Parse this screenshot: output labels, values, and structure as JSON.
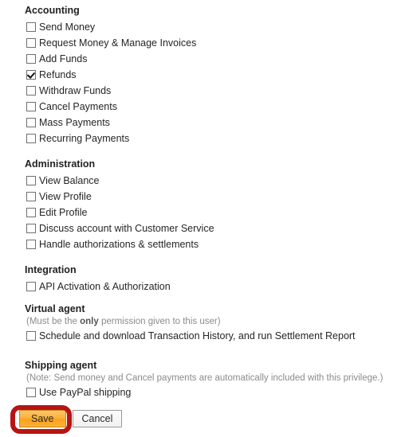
{
  "sections": [
    {
      "title": "Accounting",
      "note": null,
      "options": [
        {
          "label": "Send Money",
          "checked": false
        },
        {
          "label": "Request Money & Manage Invoices",
          "checked": false
        },
        {
          "label": "Add Funds",
          "checked": false
        },
        {
          "label": "Refunds",
          "checked": true
        },
        {
          "label": "Withdraw Funds",
          "checked": false
        },
        {
          "label": "Cancel Payments",
          "checked": false
        },
        {
          "label": "Mass Payments",
          "checked": false
        },
        {
          "label": "Recurring Payments",
          "checked": false
        }
      ]
    },
    {
      "title": "Administration",
      "note": null,
      "options": [
        {
          "label": "View Balance",
          "checked": false
        },
        {
          "label": "View Profile",
          "checked": false
        },
        {
          "label": "Edit Profile",
          "checked": false
        },
        {
          "label": "Discuss account with Customer Service",
          "checked": false
        },
        {
          "label": "Handle authorizations & settlements",
          "checked": false
        }
      ]
    },
    {
      "title": "Integration",
      "note": null,
      "options": [
        {
          "label": "API Activation & Authorization",
          "checked": false
        }
      ]
    },
    {
      "title": "Virtual agent",
      "note": {
        "before": "(Must be the ",
        "emphasis": "only",
        "after": " permission given to this user)"
      },
      "options": [
        {
          "label": "Schedule and download Transaction History, and run Settlement Report",
          "checked": false
        }
      ]
    },
    {
      "title": "Shipping agent",
      "note": {
        "before": "(Note: Send money and Cancel payments are automatically included with this privilege.)",
        "emphasis": "",
        "after": ""
      },
      "options": [
        {
          "label": "Use PayPal shipping",
          "checked": false
        }
      ]
    }
  ],
  "buttons": {
    "save_label": "Save",
    "cancel_label": "Cancel"
  },
  "colors": {
    "save_button_orange": "#f9a21b",
    "annotation_red": "#b81414",
    "note_gray": "#8b8b8b",
    "text": "#222222"
  }
}
